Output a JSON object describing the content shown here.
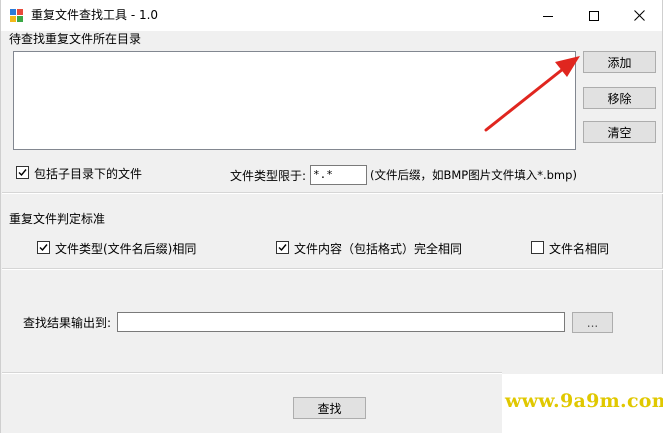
{
  "window": {
    "title": "重复文件查找工具 - 1.0"
  },
  "folders": {
    "group_label": "待查找重复文件所在目录",
    "add_label": "添加",
    "remove_label": "移除",
    "clear_label": "清空",
    "items": []
  },
  "options": {
    "include_subdirs_label": "包括子目录下的文件",
    "include_subdirs_checked": true,
    "filetype_label": "文件类型限于:",
    "filetype_value": "*.*",
    "filetype_hint": "(文件后缀，如BMP图片文件填入*.bmp)"
  },
  "criteria": {
    "group_label": "重复文件判定标准",
    "same_type_label": "文件类型(文件名后缀)相同",
    "same_type_checked": true,
    "same_content_label": "文件内容（包括格式）完全相同",
    "same_content_checked": true,
    "same_name_label": "文件名相同",
    "same_name_checked": false
  },
  "output": {
    "label": "查找结果输出到:",
    "path_value": "",
    "browse_label": "..."
  },
  "actions": {
    "search_label": "查找"
  },
  "watermark": {
    "text": "www.9a9m.com"
  },
  "colors": {
    "arrow": "#e0261f",
    "watermark": "#e0c800"
  }
}
